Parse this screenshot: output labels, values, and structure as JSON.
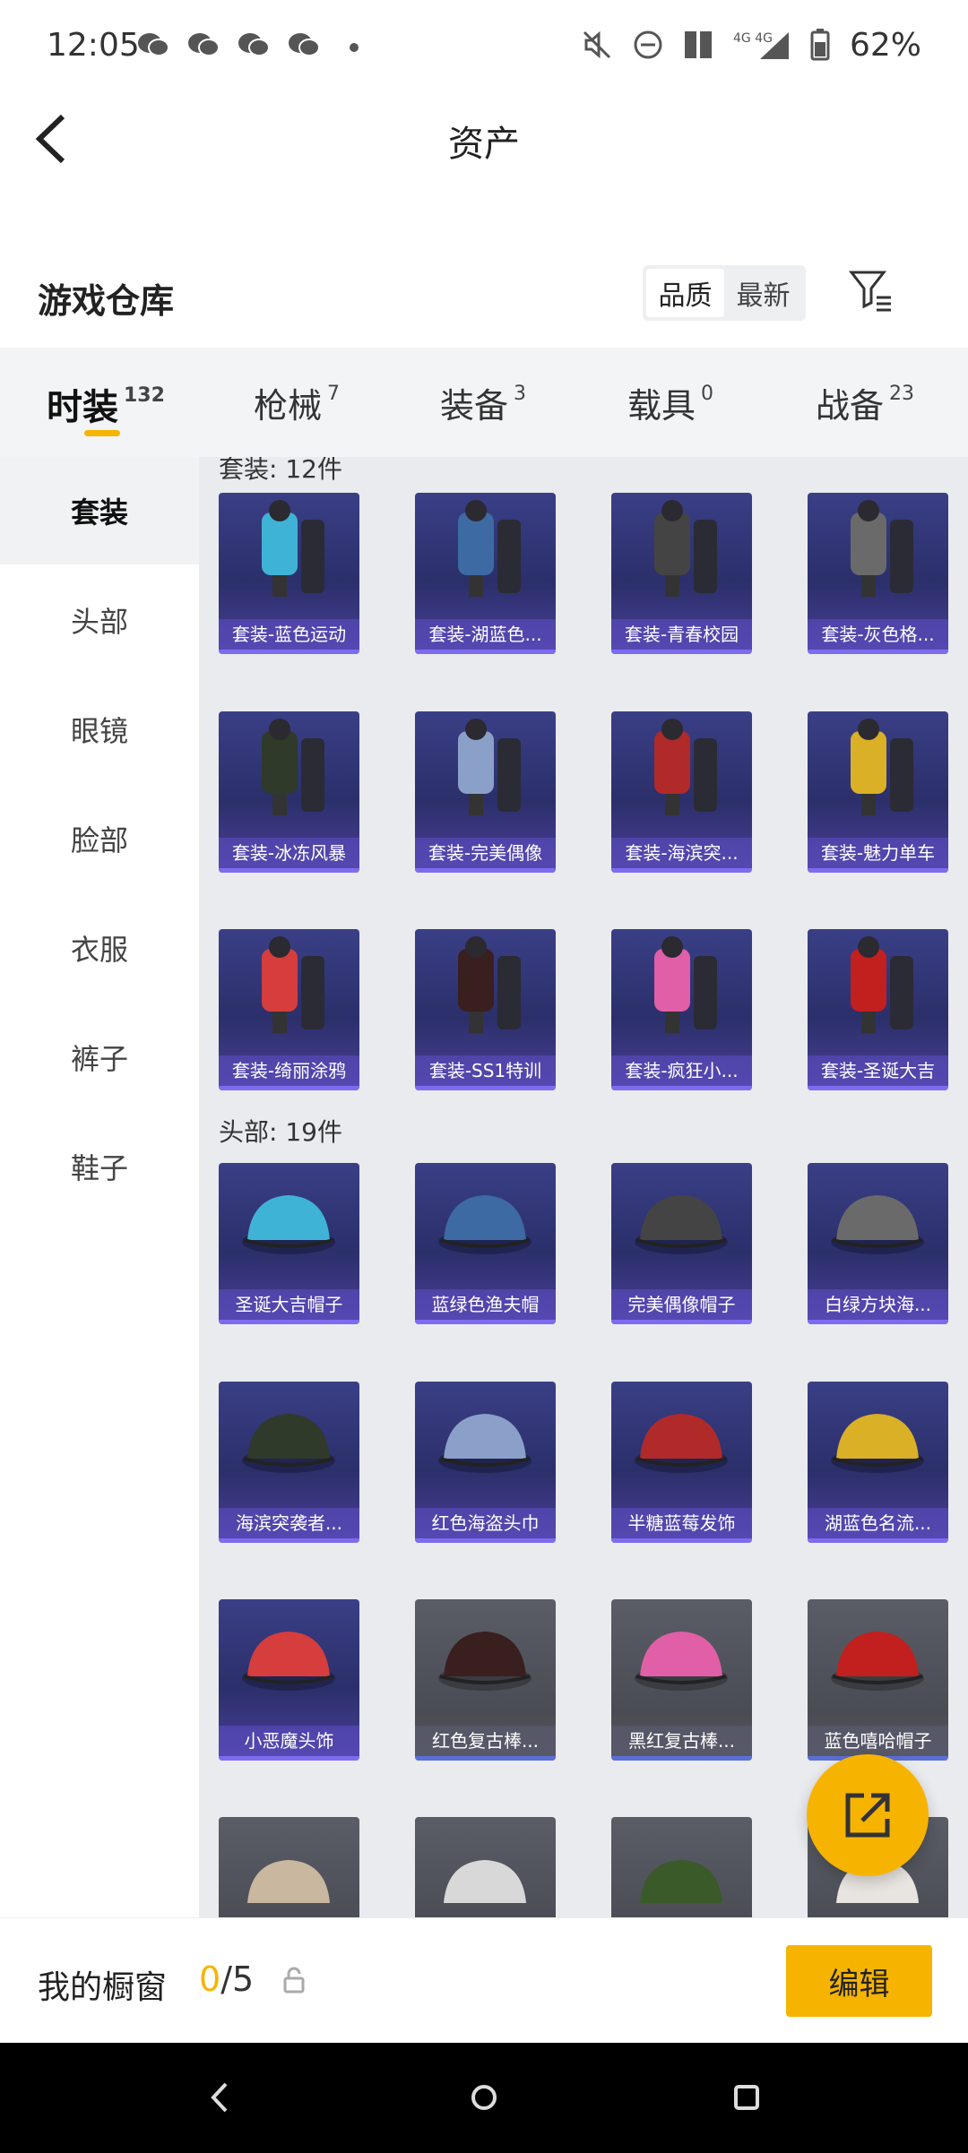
{
  "status_bar": {
    "time": "12:05",
    "battery": "62%",
    "network": "4G 4G"
  },
  "topbar": {
    "title": "资产"
  },
  "warehouse": {
    "title": "游戏仓库",
    "sort_options": [
      "品质",
      "最新"
    ],
    "sort_selected": "品质"
  },
  "tabs": [
    {
      "label": "时装",
      "count": "132"
    },
    {
      "label": "枪械",
      "count": "7"
    },
    {
      "label": "装备",
      "count": "3"
    },
    {
      "label": "载具",
      "count": "0"
    },
    {
      "label": "战备",
      "count": "23"
    }
  ],
  "sidebar": {
    "items": [
      "套装",
      "头部",
      "眼镜",
      "脸部",
      "衣服",
      "裤子",
      "鞋子"
    ]
  },
  "sections": {
    "suits_label": "套装: 12件",
    "head_label": "头部: 19件"
  },
  "suit_items": [
    "套装-蓝色运动",
    "套装-湖蓝色...",
    "套装-青春校园",
    "套装-灰色格...",
    "套装-冰冻风暴",
    "套装-完美偶像",
    "套装-海滨突...",
    "套装-魅力单车",
    "套装-绮丽涂鸦",
    "套装-SS1特训",
    "套装-疯狂小...",
    "套装-圣诞大吉"
  ],
  "head_items": [
    "圣诞大吉帽子",
    "蓝绿色渔夫帽",
    "完美偶像帽子",
    "白绿方块海...",
    "海滨突袭者...",
    "红色海盗头巾",
    "半糖蓝莓发饰",
    "湖蓝色名流...",
    "小恶魔头饰",
    "红色复古棒...",
    "黑红复古棒...",
    "蓝色嘻哈帽子"
  ],
  "bottom_bar": {
    "window_label": "我的橱窗",
    "window_current": "0",
    "window_total": "/5",
    "edit_label": "编辑"
  },
  "colors": {
    "accent": "#f6b400",
    "card_purple": "#3a3f86",
    "card_grey": "#5a5d66"
  }
}
